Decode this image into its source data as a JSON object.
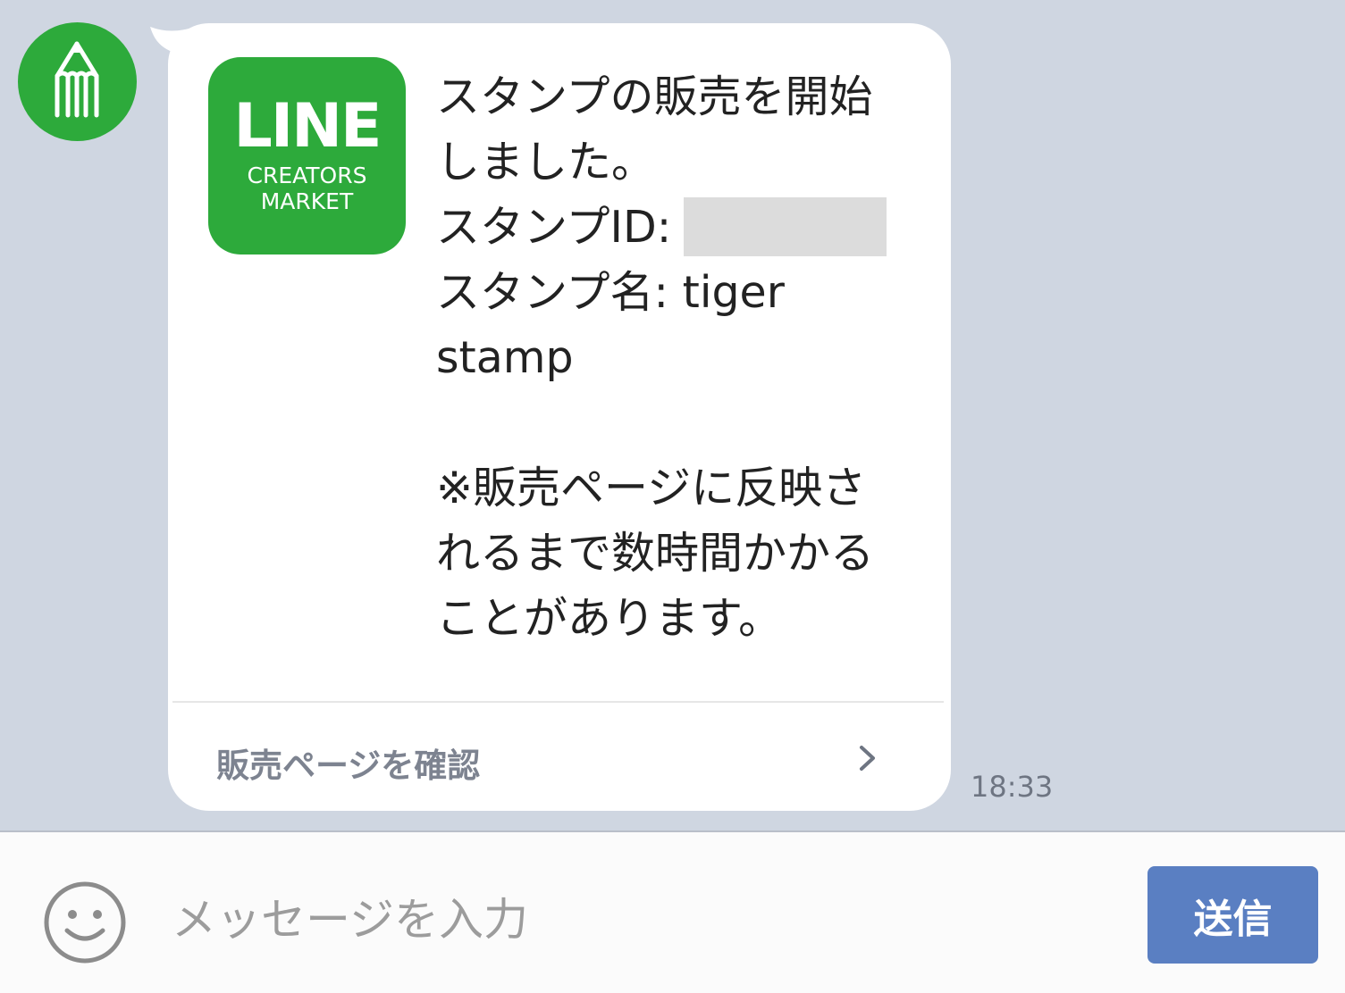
{
  "message": {
    "lines": [
      "スタンプの販売を開始",
      "しました。",
      "スタンプID:",
      "スタンプ名: tiger",
      "stamp",
      "※販売ページに反映さ",
      "れるまで数時間かかる",
      "ことがあります。"
    ],
    "logo_title": "LINE",
    "logo_subtitle_1": "CREATORS",
    "logo_subtitle_2": "MARKET",
    "action_label": "販売ページを確認",
    "time": "18:33"
  },
  "input_bar": {
    "placeholder": "メッセージを入力",
    "send_label": "送信"
  },
  "colors": {
    "chat_background": "#cfd6e1",
    "line_green": "#2daa3b",
    "send_button": "#5a7fc2"
  }
}
